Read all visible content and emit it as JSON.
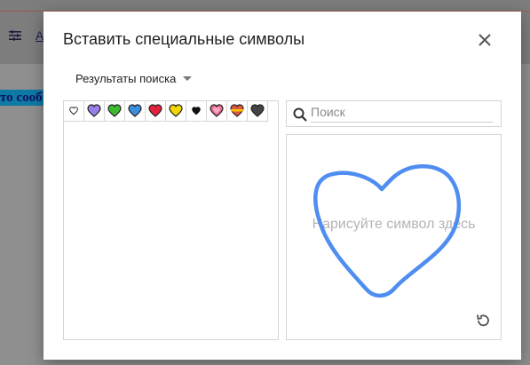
{
  "background": {
    "toolbar_link": "A",
    "document_text": "то сооб"
  },
  "dialog": {
    "title": "Вставить специальные символы",
    "filter_label": "Результаты поиска",
    "search_placeholder": "Поиск",
    "search_value": "",
    "draw_hint": "Нарисуйте символ здесь",
    "results": [
      {
        "icon": "white-heart",
        "color": "#ffffff"
      },
      {
        "icon": "purple-heart",
        "color": "#9b7ee8"
      },
      {
        "icon": "green-heart",
        "color": "#3dbb2e"
      },
      {
        "icon": "blue-heart",
        "color": "#3a8ede"
      },
      {
        "icon": "red-heart",
        "color": "#e5223c"
      },
      {
        "icon": "yellow-heart",
        "color": "#f2d800"
      },
      {
        "icon": "black-heart-suit",
        "color": "#111111"
      },
      {
        "icon": "growing-heart",
        "color": "#e86a8a"
      },
      {
        "icon": "heart-with-ribbon",
        "color": "#e0583c"
      },
      {
        "icon": "black-heart",
        "color": "#444444"
      }
    ],
    "stroke_color": "#4f8ef0"
  }
}
